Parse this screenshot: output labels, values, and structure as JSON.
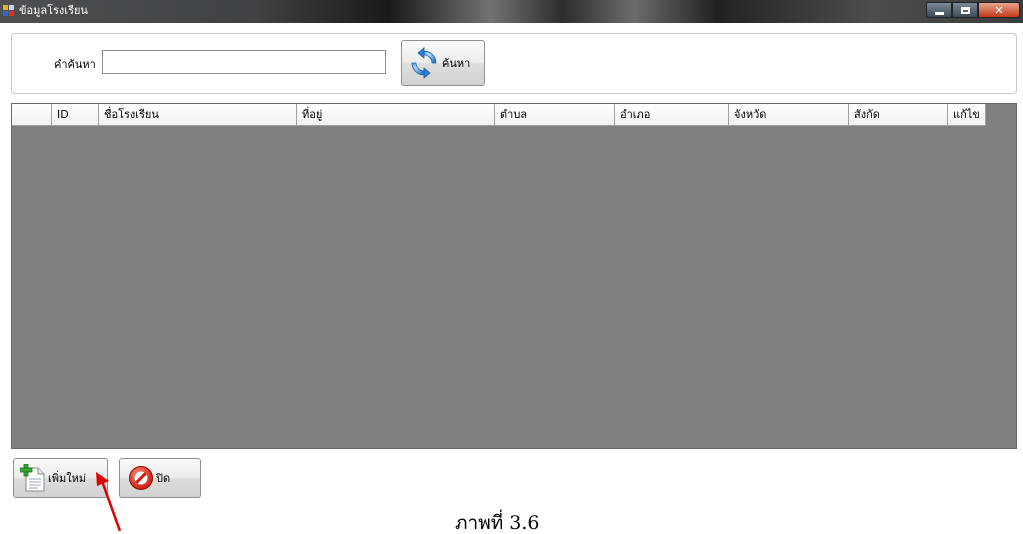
{
  "window": {
    "title": "ข้อมูลโรงเรียน",
    "icon": "app-icon",
    "controls": [
      "minimize-icon",
      "maximize-icon",
      "close-icon"
    ]
  },
  "search": {
    "label": "คำค้นหา",
    "value": "",
    "button_label": "ค้นหา",
    "button_icon": "refresh-icon"
  },
  "grid": {
    "columns": [
      "",
      "ID",
      "ชื่อโรงเรียน",
      "ที่อยู่",
      "ตำบล",
      "อำเภอ",
      "จังหวัด",
      "สังกัด",
      "แก้ไข"
    ],
    "rows": [],
    "background_color": "#808080"
  },
  "footer": {
    "add_label": "เพิ่มใหม่",
    "add_icon": "add-document-icon",
    "close_label": "ปิด",
    "close_icon": "no-entry-icon"
  },
  "annotation": {
    "arrow_color": "#e00000",
    "caption": "ภาพที่ 3.6"
  }
}
